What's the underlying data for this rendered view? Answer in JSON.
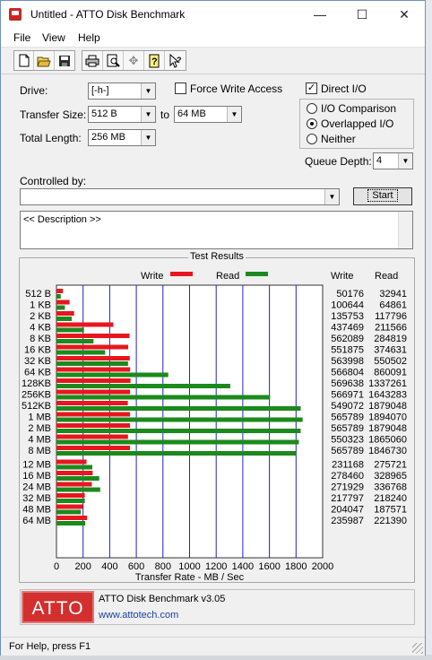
{
  "window": {
    "title": "Untitled - ATTO Disk Benchmark"
  },
  "menu": {
    "file": "File",
    "view": "View",
    "help": "Help"
  },
  "toolbar": {
    "icons": [
      "new-file-icon",
      "open-folder-icon",
      "save-icon",
      "print-icon",
      "print-preview-icon",
      "move-icon",
      "help-icon",
      "context-help-icon"
    ]
  },
  "settings": {
    "drive_label": "Drive:",
    "drive_value": "[-h-]",
    "transfer_size_label": "Transfer Size:",
    "transfer_from": "512 B",
    "to_label": "to",
    "transfer_to": "64 MB",
    "total_length_label": "Total Length:",
    "total_length_value": "256 MB",
    "force_write_access_label": "Force Write Access",
    "force_write_access_checked": false,
    "direct_io_label": "Direct I/O",
    "direct_io_checked": true,
    "io_mode_options": [
      "I/O Comparison",
      "Overlapped I/O",
      "Neither"
    ],
    "io_mode_selected": "Overlapped I/O",
    "queue_depth_label": "Queue Depth:",
    "queue_depth_value": "4",
    "controlled_by_label": "Controlled by:",
    "controlled_by_value": "",
    "start_label": "Start"
  },
  "description": {
    "text": "<< Description >>"
  },
  "results": {
    "title": "Test Results",
    "write_legend": "Write",
    "read_legend": "Read",
    "write_col_header": "Write",
    "read_col_header": "Read",
    "axis_label": "Transfer Rate - MB / Sec",
    "write_color": "#e8161e",
    "read_color": "#1c8a1c",
    "grid_color": "#2222bb"
  },
  "chart_data": {
    "type": "bar",
    "orientation": "horizontal",
    "categories": [
      "512 B",
      "1 KB",
      "2 KB",
      "4 KB",
      "8 KB",
      "16 KB",
      "32 KB",
      "64 KB",
      "128KB",
      "256KB",
      "512KB",
      "1 MB",
      "2 MB",
      "4 MB",
      "8 MB",
      "12 MB",
      "16 MB",
      "24 MB",
      "32 MB",
      "48 MB",
      "64 MB"
    ],
    "series": [
      {
        "name": "Write",
        "values": [
          50176,
          100644,
          135753,
          437469,
          562089,
          551875,
          563998,
          566804,
          569638,
          566971,
          549072,
          565789,
          565789,
          550323,
          565789,
          231168,
          278460,
          271929,
          217797,
          204047,
          235987
        ]
      },
      {
        "name": "Read",
        "values": [
          32941,
          64861,
          117796,
          211566,
          284819,
          374631,
          550502,
          860091,
          1337261,
          1643283,
          1879048,
          1894070,
          1879048,
          1865060,
          1846730,
          275721,
          328965,
          336768,
          218240,
          187571,
          221390
        ]
      }
    ],
    "bar_units": "KB/s",
    "xlabel": "Transfer Rate - MB / Sec",
    "xlim": [
      0,
      2000
    ],
    "xticks": [
      "0",
      "200",
      "400",
      "600",
      "800",
      "1000",
      "1200",
      "1400",
      "1600",
      "1800",
      "2000"
    ],
    "grid": true,
    "legend": "top"
  },
  "footer": {
    "logo_text": "ATTO",
    "product": "ATTO Disk Benchmark v3.05",
    "url": "www.attotech.com"
  },
  "status": {
    "text": "For Help, press F1"
  }
}
